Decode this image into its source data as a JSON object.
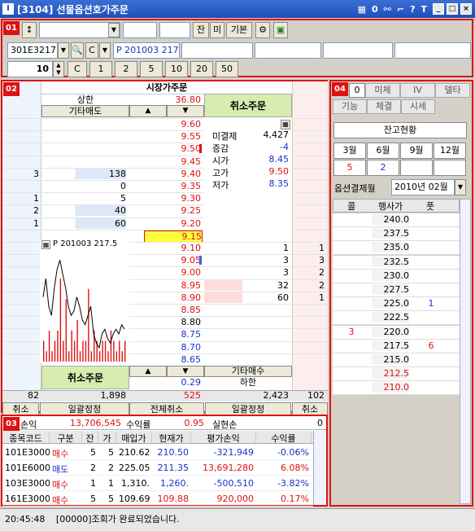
{
  "window": {
    "title": "[3104] 선물옵션호가주문",
    "icons": [
      "grid-icon",
      "zero-icon",
      "link-icon",
      "bracket-icon",
      "help-icon",
      "t-icon",
      "minimize-icon",
      "maximize-icon",
      "close-icon"
    ],
    "help": "?",
    "zero": "0",
    "t": "T"
  },
  "sec1": {
    "badge": "01",
    "btn_jan": "잔",
    "btn_mi": "미",
    "btn_basic": "기본",
    "code": "301E3217",
    "c": "C",
    "name": "P 201003 217",
    "qty": "10",
    "c2": "C",
    "qty_buttons": [
      "1",
      "2",
      "5",
      "10",
      "20",
      "50"
    ]
  },
  "sec2": {
    "badge": "02",
    "market_order": "시장가주문",
    "upper_label": "상한",
    "upper_price": "36.80",
    "cancel_order": "취소주문",
    "other_sell": "기타매도",
    "other_buy": "기타매수",
    "lower_label": "하한",
    "up_arrow": "▲",
    "down_arrow": "▼",
    "prices": [
      "9.60",
      "9.55",
      "9.50",
      "9.45",
      "9.40",
      "9.35",
      "9.30",
      "9.25",
      "9.20",
      "9.15",
      "9.10",
      "9.05",
      "9.00",
      "8.95",
      "8.90",
      "8.85",
      "8.80",
      "8.75",
      "8.70",
      "8.65"
    ],
    "sell_qty": [
      "",
      "",
      "",
      "",
      "138",
      "0",
      "5",
      "40",
      "60",
      "",
      "",
      "",
      "",
      "",
      "",
      "",
      "",
      "",
      "",
      ""
    ],
    "sell_cnt": [
      "",
      "",
      "",
      "",
      "3",
      "",
      "1",
      "2",
      "1",
      "",
      "",
      "",
      "",
      "",
      "",
      "",
      "",
      "",
      "",
      ""
    ],
    "buy_qty": [
      "",
      "",
      "",
      "",
      "",
      "",
      "",
      "",
      "",
      "",
      "1",
      "3",
      "3",
      "32",
      "60",
      "",
      "",
      "",
      "",
      ""
    ],
    "buy_cnt": [
      "",
      "",
      "",
      "",
      "",
      "",
      "",
      "",
      "",
      "",
      "1",
      "3",
      "2",
      "2",
      "1",
      "",
      "",
      "",
      "",
      ""
    ],
    "current": "0.29",
    "info": [
      {
        "label": "미결제",
        "value": "4,427"
      },
      {
        "label": "증감",
        "value": "-4"
      },
      {
        "label": "시가",
        "value": "8.45"
      },
      {
        "label": "고가",
        "value": "9.50"
      },
      {
        "label": "저가",
        "value": "8.35"
      }
    ],
    "chart_title": "P 201003 217.5",
    "total_sell_cnt": "82",
    "total_sell_qty": "1,898",
    "total_diff": "525",
    "total_buy_qty": "2,423",
    "total_buy_cnt": "102",
    "bottom_buttons": [
      "취소",
      "일괄정정",
      "전체취소",
      "일괄정정",
      "취소"
    ]
  },
  "sec3": {
    "badge": "03",
    "summary": [
      {
        "label": "손익",
        "value": "13,706,545"
      },
      {
        "label": "수익률",
        "value": "0.95"
      },
      {
        "label": "실현손",
        "value": "0"
      }
    ],
    "headers": [
      "종목코드",
      "구분",
      "잔",
      "가",
      "매입가",
      "현재가",
      "평가손익",
      "수익률"
    ],
    "rows": [
      [
        "101E3000",
        "매수",
        "5",
        "5",
        "210.62",
        "210.50",
        "-321,949",
        "-0.06%"
      ],
      [
        "101E6000",
        "매도",
        "2",
        "2",
        "225.05",
        "211.35",
        "13,691,280",
        "6.08%"
      ],
      [
        "103E3000",
        "매수",
        "1",
        "1",
        "1,310.",
        "1,260.",
        "-500,510",
        "-3.82%"
      ],
      [
        "161E3000",
        "매수",
        "5",
        "5",
        "109.69",
        "109.88",
        "920,000",
        "0.17%"
      ]
    ]
  },
  "sec4": {
    "badge": "04",
    "tabs_row1": [
      "미체",
      "IV",
      "델타"
    ],
    "tabs_row2": [
      "기능",
      "체결",
      "시세"
    ],
    "tab0": "0",
    "balance_btn": "잔고현황",
    "months": [
      "3월",
      "6월",
      "9월",
      "12월"
    ],
    "month_vals": [
      "5",
      "2",
      "",
      ""
    ],
    "expiry_label": "옵션결제월",
    "expiry_value": "2010년 02월",
    "opt_headers": [
      "콜",
      "행사가",
      "풋"
    ],
    "strikes": [
      "240.0",
      "237.5",
      "235.0",
      "232.5",
      "230.0",
      "227.5",
      "225.0",
      "222.5",
      "220.0",
      "217.5",
      "215.0",
      "212.5",
      "210.0"
    ],
    "calls": [
      "",
      "",
      "",
      "",
      "",
      "",
      "",
      "",
      "3",
      "",
      "",
      "",
      ""
    ],
    "puts": [
      "",
      "",
      "",
      "",
      "",
      "",
      "1",
      "",
      "",
      "6",
      "",
      "",
      ""
    ]
  },
  "status": {
    "time": "20:45:48",
    "message": "[00000]조회가 완료되었습니다."
  },
  "chart_data": {
    "type": "line",
    "title": "P 201003 217.5",
    "x": [
      1,
      2,
      3,
      4,
      5,
      6,
      7,
      8,
      9,
      10,
      11,
      12,
      13,
      14,
      15,
      16,
      17,
      18,
      19,
      20,
      21,
      22,
      23,
      24,
      25,
      26,
      27,
      28,
      29,
      30
    ],
    "values": [
      9.1,
      9.3,
      9.0,
      8.9,
      9.2,
      9.4,
      9.5,
      9.35,
      9.2,
      9.0,
      8.9,
      8.95,
      9.1,
      9.0,
      8.85,
      8.8,
      8.9,
      9.0,
      8.7,
      8.6,
      8.55,
      8.7,
      8.75,
      8.65,
      8.6,
      8.7,
      8.75,
      8.7,
      8.8,
      8.75
    ],
    "volume": [
      2,
      1,
      3,
      1,
      2,
      3,
      8,
      2,
      6,
      1,
      3,
      2,
      4,
      1,
      2,
      2,
      7,
      1,
      3,
      2,
      1,
      2,
      2,
      1,
      3,
      2,
      1,
      2,
      1,
      2
    ],
    "ylim": [
      8.4,
      9.6
    ]
  }
}
